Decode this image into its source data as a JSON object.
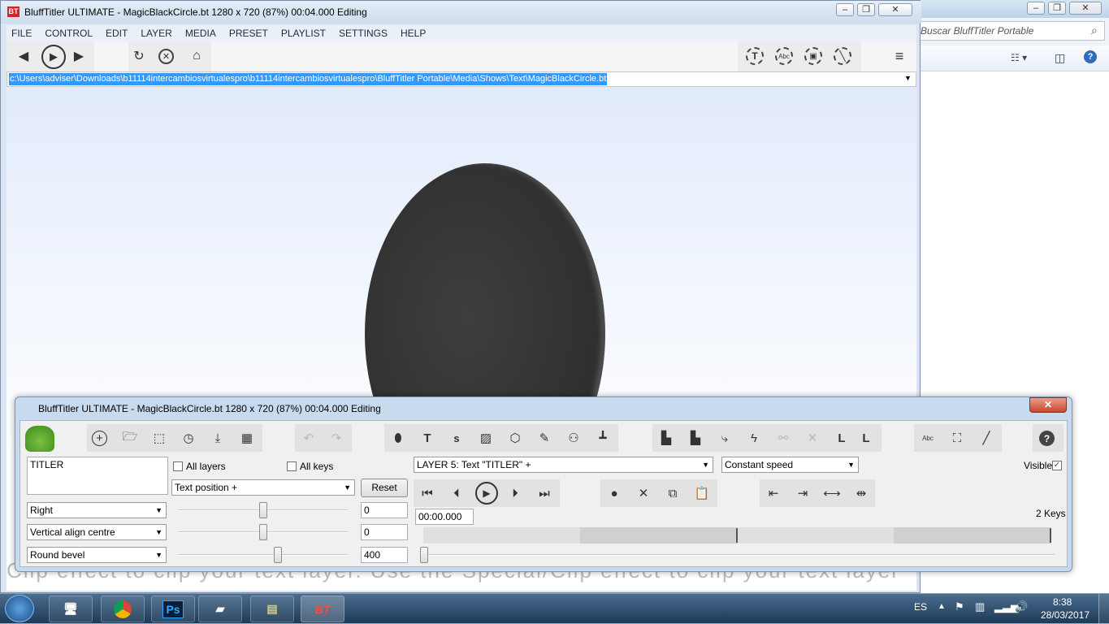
{
  "explorer": {
    "search_placeholder": "Buscar BluffTitler Portable"
  },
  "main": {
    "title": "BluffTitler ULTIMATE  - MagicBlackCircle.bt 1280 x 720 (87%) 00:04.000 Editing",
    "app_icon": "BT",
    "menu": [
      "FILE",
      "CONTROL",
      "EDIT",
      "LAYER",
      "MEDIA",
      "PRESET",
      "PLAYLIST",
      "SETTINGS",
      "HELP"
    ],
    "path": "c:\\Users\\adviser\\Downloads\\b11114intercambiosvirtualespro\\b11114intercambiosvirtualespro\\BluffTitler Portable\\Media\\Shows\\Text\\MagicBlackCircle.bt",
    "caption_text": "Clip effect to clip your text layer.  Use the Special/Clip effect to clip your text layer"
  },
  "dialog": {
    "title": "BluffTitler ULTIMATE  - MagicBlackCircle.bt 1280 x 720 (87%) 00:04.000 Editing",
    "close_label": "✕",
    "text_value": "TITLER",
    "all_layers_label": "All layers",
    "all_keys_label": "All keys",
    "property_select": "Text position +",
    "reset_label": "Reset",
    "layer_select": "LAYER 5: Text \"TITLER\" +",
    "speed_select": "Constant speed",
    "visible_label": "Visible",
    "visible_checked": true,
    "rows": [
      {
        "select": "Right",
        "value": "0",
        "level": 0.5
      },
      {
        "select": "Vertical align centre",
        "value": "0",
        "level": 0.5
      },
      {
        "select": "Round bevel",
        "value": "400",
        "level": 0.59
      }
    ],
    "time_value": "00:00.000",
    "keys_label": "2 Keys"
  },
  "taskbar": {
    "lang": "ES",
    "clock_time": "8:38",
    "clock_date": "28/03/2017",
    "bt_label": "BT",
    "ps_label": "Ps"
  }
}
